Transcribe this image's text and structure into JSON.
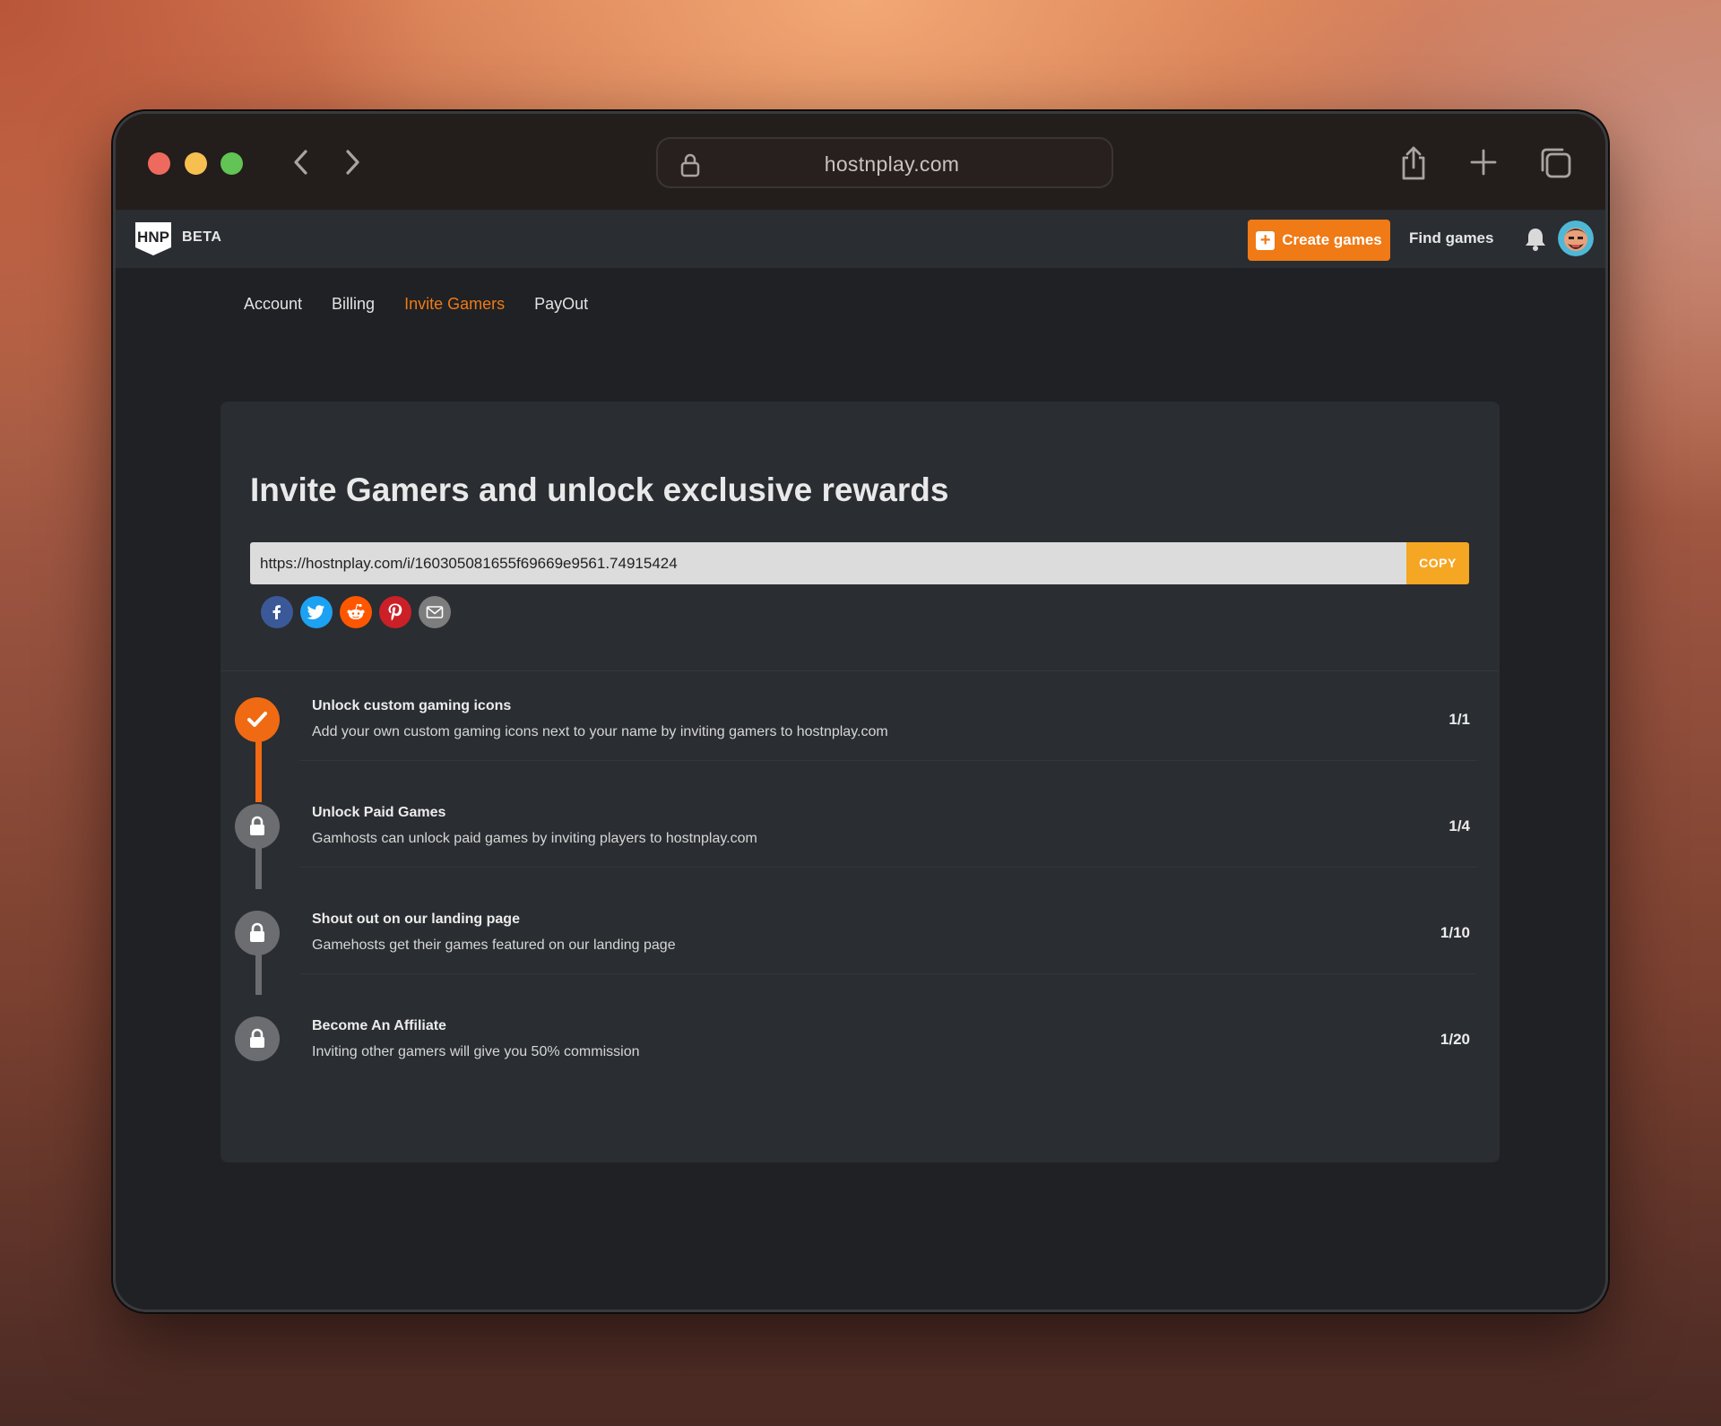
{
  "browser": {
    "url": "hostnplay.com"
  },
  "header": {
    "logo_text": "HNP",
    "beta": "BETA",
    "create_label": "Create games",
    "find_label": "Find games"
  },
  "tabs": [
    {
      "label": "Account",
      "active": false
    },
    {
      "label": "Billing",
      "active": false
    },
    {
      "label": "Invite Gamers",
      "active": true
    },
    {
      "label": "PayOut",
      "active": false
    }
  ],
  "invite": {
    "title": "Invite Gamers and unlock exclusive rewards",
    "link": "https://hostnplay.com/i/160305081655f69669e9561.74915424",
    "copy_label": "COPY",
    "socials": [
      {
        "name": "facebook-icon",
        "color": "#3b5998"
      },
      {
        "name": "twitter-icon",
        "color": "#1da1f2"
      },
      {
        "name": "reddit-icon",
        "color": "#ff5700"
      },
      {
        "name": "pinterest-icon",
        "color": "#cb2027"
      },
      {
        "name": "email-icon",
        "color": "#7d7d7d"
      }
    ]
  },
  "rewards": [
    {
      "title": "Unlock custom gaming icons",
      "desc": "Add your own custom gaming icons next to your name by inviting gamers to hostnplay.com",
      "count": "1/1",
      "status": "done"
    },
    {
      "title": "Unlock Paid Games",
      "desc": "Gamhosts can unlock paid games by inviting players to hostnplay.com",
      "count": "1/4",
      "status": "locked"
    },
    {
      "title": "Shout out on our landing page",
      "desc": "Gamehosts get their games featured on our landing page",
      "count": "1/10",
      "status": "locked"
    },
    {
      "title": "Become An Affiliate",
      "desc": "Inviting other gamers will give you 50% commission",
      "count": "1/20",
      "status": "locked"
    }
  ],
  "colors": {
    "accent": "#ef7a16",
    "copy": "#f5a623",
    "locked": "#6b6d70"
  }
}
